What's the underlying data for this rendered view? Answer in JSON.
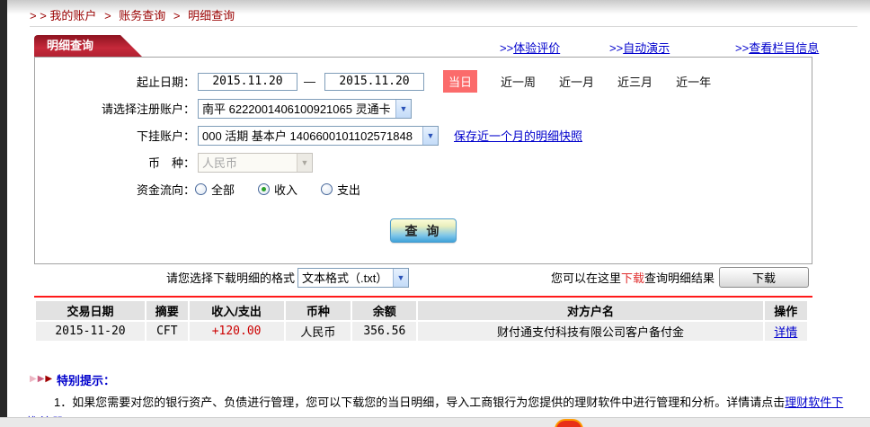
{
  "breadcrumb": {
    "prefix": "> >",
    "sep": ">",
    "items": [
      "我的账户",
      "账务查询",
      "明细查询"
    ]
  },
  "header": {
    "tab_label": "明细查询",
    "links": [
      {
        "prefix": ">>",
        "label": "体验评价"
      },
      {
        "prefix": ">>",
        "label": "自动演示"
      },
      {
        "prefix": ">>",
        "label": "查看栏目信息"
      }
    ]
  },
  "form": {
    "date_label": "起止日期：",
    "date_from": "2015.11.20",
    "date_to": "2015.11.20",
    "date_separator": "—",
    "quick": [
      {
        "label": "当日",
        "active": true
      },
      {
        "label": "近一周",
        "active": false
      },
      {
        "label": "近一月",
        "active": false
      },
      {
        "label": "近三月",
        "active": false
      },
      {
        "label": "近一年",
        "active": false
      }
    ],
    "account_label": "请选择注册账户：",
    "account_value": "南平 6222001406100921065 灵通卡",
    "sub_account_label": "下挂账户：",
    "sub_account_value": "000 活期 基本户 1406600101102571848",
    "snapshot_link": "保存近一个月的明细快照",
    "currency_label": "币　种：",
    "currency_value": "人民币",
    "flow_label": "资金流向：",
    "flow": [
      {
        "label": "全部",
        "checked": false
      },
      {
        "label": "收入",
        "checked": true
      },
      {
        "label": "支出",
        "checked": false
      }
    ],
    "query_button": "查 询"
  },
  "download": {
    "format_label": "请您选择下载明细的格式",
    "format_value": "文本格式（.txt）",
    "hint_pre": "您可以在这里",
    "hint_em": "下载",
    "hint_post": "查询明细结果",
    "button_label": "下载"
  },
  "table": {
    "headers": [
      "交易日期",
      "摘要",
      "收入/支出",
      "币种",
      "余额",
      "对方户名",
      "操作"
    ],
    "rows": [
      {
        "date": "2015-11-20",
        "summary": "CFT",
        "amount": "+120.00",
        "currency": "人民币",
        "balance": "356.56",
        "counterparty": "财付通支付科技有限公司客户备付金",
        "action": "详情"
      }
    ]
  },
  "notice": {
    "arrow_glyph": "▶▶▶",
    "title": "特别提示：",
    "text": "1．如果您需要对您的银行资产、负债进行管理，您可以下载您的当日明细，导入工商银行为您提供的理财软件中进行管理和分析。详情请点击",
    "link": "理财软件下载/注册"
  },
  "colors": {
    "breadcrumb_red": "#990000",
    "tab_red": "#c5293a",
    "link_blue": "#0000cc",
    "active_range_red": "#fb6b6b",
    "amount_red": "#cc0000",
    "divider_red": "#ff1a1a"
  }
}
